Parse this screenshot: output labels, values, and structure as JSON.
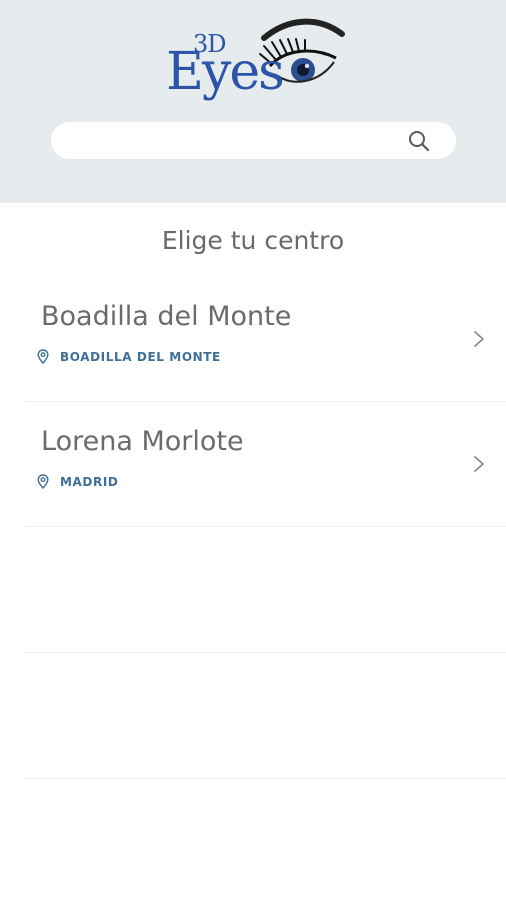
{
  "header": {
    "logo": {
      "top_text": "3D",
      "main_text": "Eyes"
    },
    "search": {
      "value": "",
      "placeholder": "",
      "icon": "search-icon"
    }
  },
  "main": {
    "title": "Elige tu centro",
    "centers": [
      {
        "name": "Boadilla del Monte",
        "location": "BOADILLA DEL MONTE",
        "icon": "map-pin-icon"
      },
      {
        "name": "Lorena Morlote",
        "location": "MADRID",
        "icon": "map-pin-icon"
      }
    ]
  },
  "colors": {
    "header_background": "#e6ebee",
    "brand_blue": "#2c54a8",
    "location_text": "#3f6f98",
    "title_text": "#6a6a6a"
  }
}
